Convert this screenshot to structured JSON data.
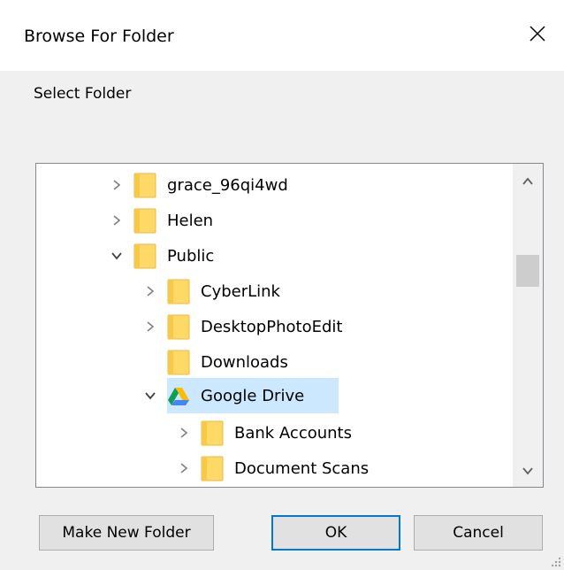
{
  "dialog": {
    "title": "Browse For Folder",
    "close_label": "✕",
    "instruction": "Select Folder"
  },
  "tree": {
    "items": [
      {
        "label": "grace_96qi4wd",
        "expander": "collapsed",
        "icon": "folder-icon",
        "level": 0
      },
      {
        "label": "Helen",
        "expander": "collapsed",
        "icon": "folder-icon",
        "level": 0
      },
      {
        "label": "Public",
        "expander": "expanded",
        "icon": "folder-icon",
        "level": 0
      },
      {
        "label": "CyberLink",
        "expander": "collapsed",
        "icon": "folder-icon",
        "level": 1
      },
      {
        "label": "DesktopPhotoEdit",
        "expander": "collapsed",
        "icon": "folder-icon",
        "level": 1
      },
      {
        "label": "Downloads",
        "expander": "none",
        "icon": "folder-icon",
        "level": 1
      },
      {
        "label": "Google Drive",
        "expander": "expanded",
        "icon": "google-drive-icon",
        "level": 1,
        "selected": true
      },
      {
        "label": "Bank Accounts",
        "expander": "collapsed",
        "icon": "folder-icon",
        "level": 2
      },
      {
        "label": "Document Scans",
        "expander": "collapsed",
        "icon": "folder-icon",
        "level": 2
      }
    ]
  },
  "buttons": {
    "make_new_folder": "Make New Folder",
    "ok": "OK",
    "cancel": "Cancel"
  },
  "colors": {
    "selection": "#cce8ff",
    "default_button_border": "#0078d7",
    "folder_yellow": "#ffd966"
  }
}
